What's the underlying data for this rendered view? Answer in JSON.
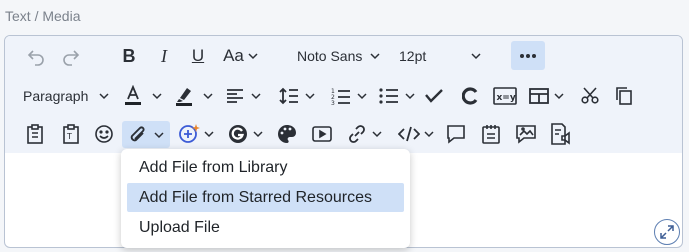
{
  "field": {
    "label": "Text / Media"
  },
  "toolbar": {
    "font_family": "Noto Sans",
    "font_size": "12pt",
    "block_format": "Paragraph",
    "font_style_glyph": "Aa"
  },
  "attach_menu": {
    "items": [
      {
        "label": "Add File from Library",
        "selected": false
      },
      {
        "label": "Add File from Starred Resources",
        "selected": true
      },
      {
        "label": "Upload File",
        "selected": false
      }
    ]
  },
  "colors": {
    "toolbar_bg": "#eff3fa",
    "active_bg": "#cfe0f7",
    "border": "#b9c3d3",
    "accent": "#3f5f95"
  }
}
